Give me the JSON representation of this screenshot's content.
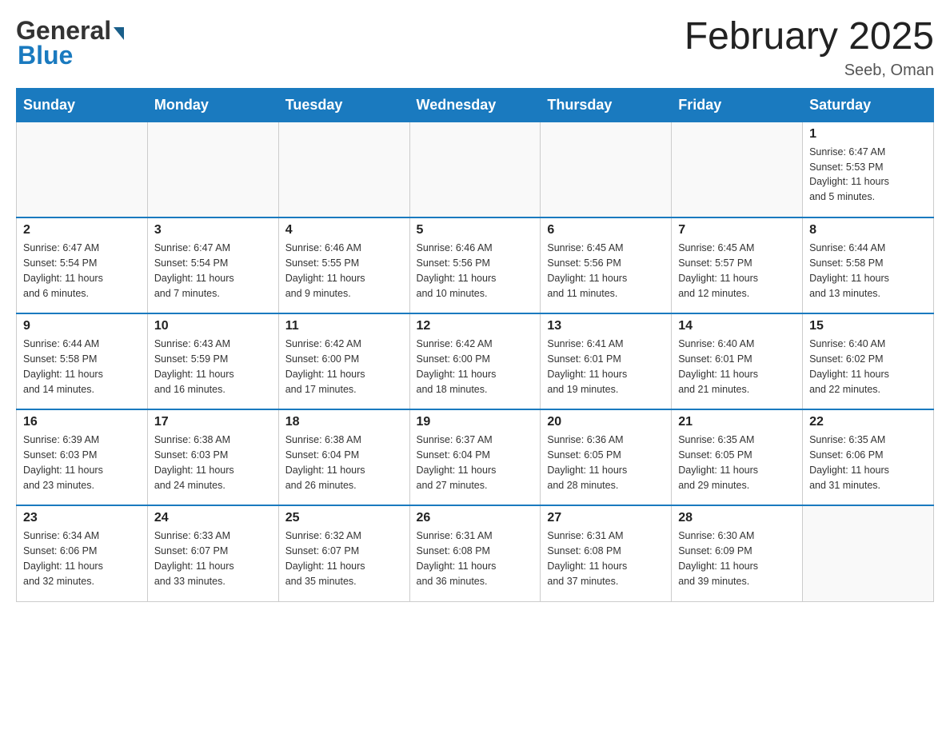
{
  "header": {
    "logo_general": "General",
    "logo_blue": "Blue",
    "month_title": "February 2025",
    "location": "Seeb, Oman"
  },
  "days_of_week": [
    "Sunday",
    "Monday",
    "Tuesday",
    "Wednesday",
    "Thursday",
    "Friday",
    "Saturday"
  ],
  "weeks": [
    [
      {
        "day": "",
        "info": ""
      },
      {
        "day": "",
        "info": ""
      },
      {
        "day": "",
        "info": ""
      },
      {
        "day": "",
        "info": ""
      },
      {
        "day": "",
        "info": ""
      },
      {
        "day": "",
        "info": ""
      },
      {
        "day": "1",
        "info": "Sunrise: 6:47 AM\nSunset: 5:53 PM\nDaylight: 11 hours\nand 5 minutes."
      }
    ],
    [
      {
        "day": "2",
        "info": "Sunrise: 6:47 AM\nSunset: 5:54 PM\nDaylight: 11 hours\nand 6 minutes."
      },
      {
        "day": "3",
        "info": "Sunrise: 6:47 AM\nSunset: 5:54 PM\nDaylight: 11 hours\nand 7 minutes."
      },
      {
        "day": "4",
        "info": "Sunrise: 6:46 AM\nSunset: 5:55 PM\nDaylight: 11 hours\nand 9 minutes."
      },
      {
        "day": "5",
        "info": "Sunrise: 6:46 AM\nSunset: 5:56 PM\nDaylight: 11 hours\nand 10 minutes."
      },
      {
        "day": "6",
        "info": "Sunrise: 6:45 AM\nSunset: 5:56 PM\nDaylight: 11 hours\nand 11 minutes."
      },
      {
        "day": "7",
        "info": "Sunrise: 6:45 AM\nSunset: 5:57 PM\nDaylight: 11 hours\nand 12 minutes."
      },
      {
        "day": "8",
        "info": "Sunrise: 6:44 AM\nSunset: 5:58 PM\nDaylight: 11 hours\nand 13 minutes."
      }
    ],
    [
      {
        "day": "9",
        "info": "Sunrise: 6:44 AM\nSunset: 5:58 PM\nDaylight: 11 hours\nand 14 minutes."
      },
      {
        "day": "10",
        "info": "Sunrise: 6:43 AM\nSunset: 5:59 PM\nDaylight: 11 hours\nand 16 minutes."
      },
      {
        "day": "11",
        "info": "Sunrise: 6:42 AM\nSunset: 6:00 PM\nDaylight: 11 hours\nand 17 minutes."
      },
      {
        "day": "12",
        "info": "Sunrise: 6:42 AM\nSunset: 6:00 PM\nDaylight: 11 hours\nand 18 minutes."
      },
      {
        "day": "13",
        "info": "Sunrise: 6:41 AM\nSunset: 6:01 PM\nDaylight: 11 hours\nand 19 minutes."
      },
      {
        "day": "14",
        "info": "Sunrise: 6:40 AM\nSunset: 6:01 PM\nDaylight: 11 hours\nand 21 minutes."
      },
      {
        "day": "15",
        "info": "Sunrise: 6:40 AM\nSunset: 6:02 PM\nDaylight: 11 hours\nand 22 minutes."
      }
    ],
    [
      {
        "day": "16",
        "info": "Sunrise: 6:39 AM\nSunset: 6:03 PM\nDaylight: 11 hours\nand 23 minutes."
      },
      {
        "day": "17",
        "info": "Sunrise: 6:38 AM\nSunset: 6:03 PM\nDaylight: 11 hours\nand 24 minutes."
      },
      {
        "day": "18",
        "info": "Sunrise: 6:38 AM\nSunset: 6:04 PM\nDaylight: 11 hours\nand 26 minutes."
      },
      {
        "day": "19",
        "info": "Sunrise: 6:37 AM\nSunset: 6:04 PM\nDaylight: 11 hours\nand 27 minutes."
      },
      {
        "day": "20",
        "info": "Sunrise: 6:36 AM\nSunset: 6:05 PM\nDaylight: 11 hours\nand 28 minutes."
      },
      {
        "day": "21",
        "info": "Sunrise: 6:35 AM\nSunset: 6:05 PM\nDaylight: 11 hours\nand 29 minutes."
      },
      {
        "day": "22",
        "info": "Sunrise: 6:35 AM\nSunset: 6:06 PM\nDaylight: 11 hours\nand 31 minutes."
      }
    ],
    [
      {
        "day": "23",
        "info": "Sunrise: 6:34 AM\nSunset: 6:06 PM\nDaylight: 11 hours\nand 32 minutes."
      },
      {
        "day": "24",
        "info": "Sunrise: 6:33 AM\nSunset: 6:07 PM\nDaylight: 11 hours\nand 33 minutes."
      },
      {
        "day": "25",
        "info": "Sunrise: 6:32 AM\nSunset: 6:07 PM\nDaylight: 11 hours\nand 35 minutes."
      },
      {
        "day": "26",
        "info": "Sunrise: 6:31 AM\nSunset: 6:08 PM\nDaylight: 11 hours\nand 36 minutes."
      },
      {
        "day": "27",
        "info": "Sunrise: 6:31 AM\nSunset: 6:08 PM\nDaylight: 11 hours\nand 37 minutes."
      },
      {
        "day": "28",
        "info": "Sunrise: 6:30 AM\nSunset: 6:09 PM\nDaylight: 11 hours\nand 39 minutes."
      },
      {
        "day": "",
        "info": ""
      }
    ]
  ]
}
